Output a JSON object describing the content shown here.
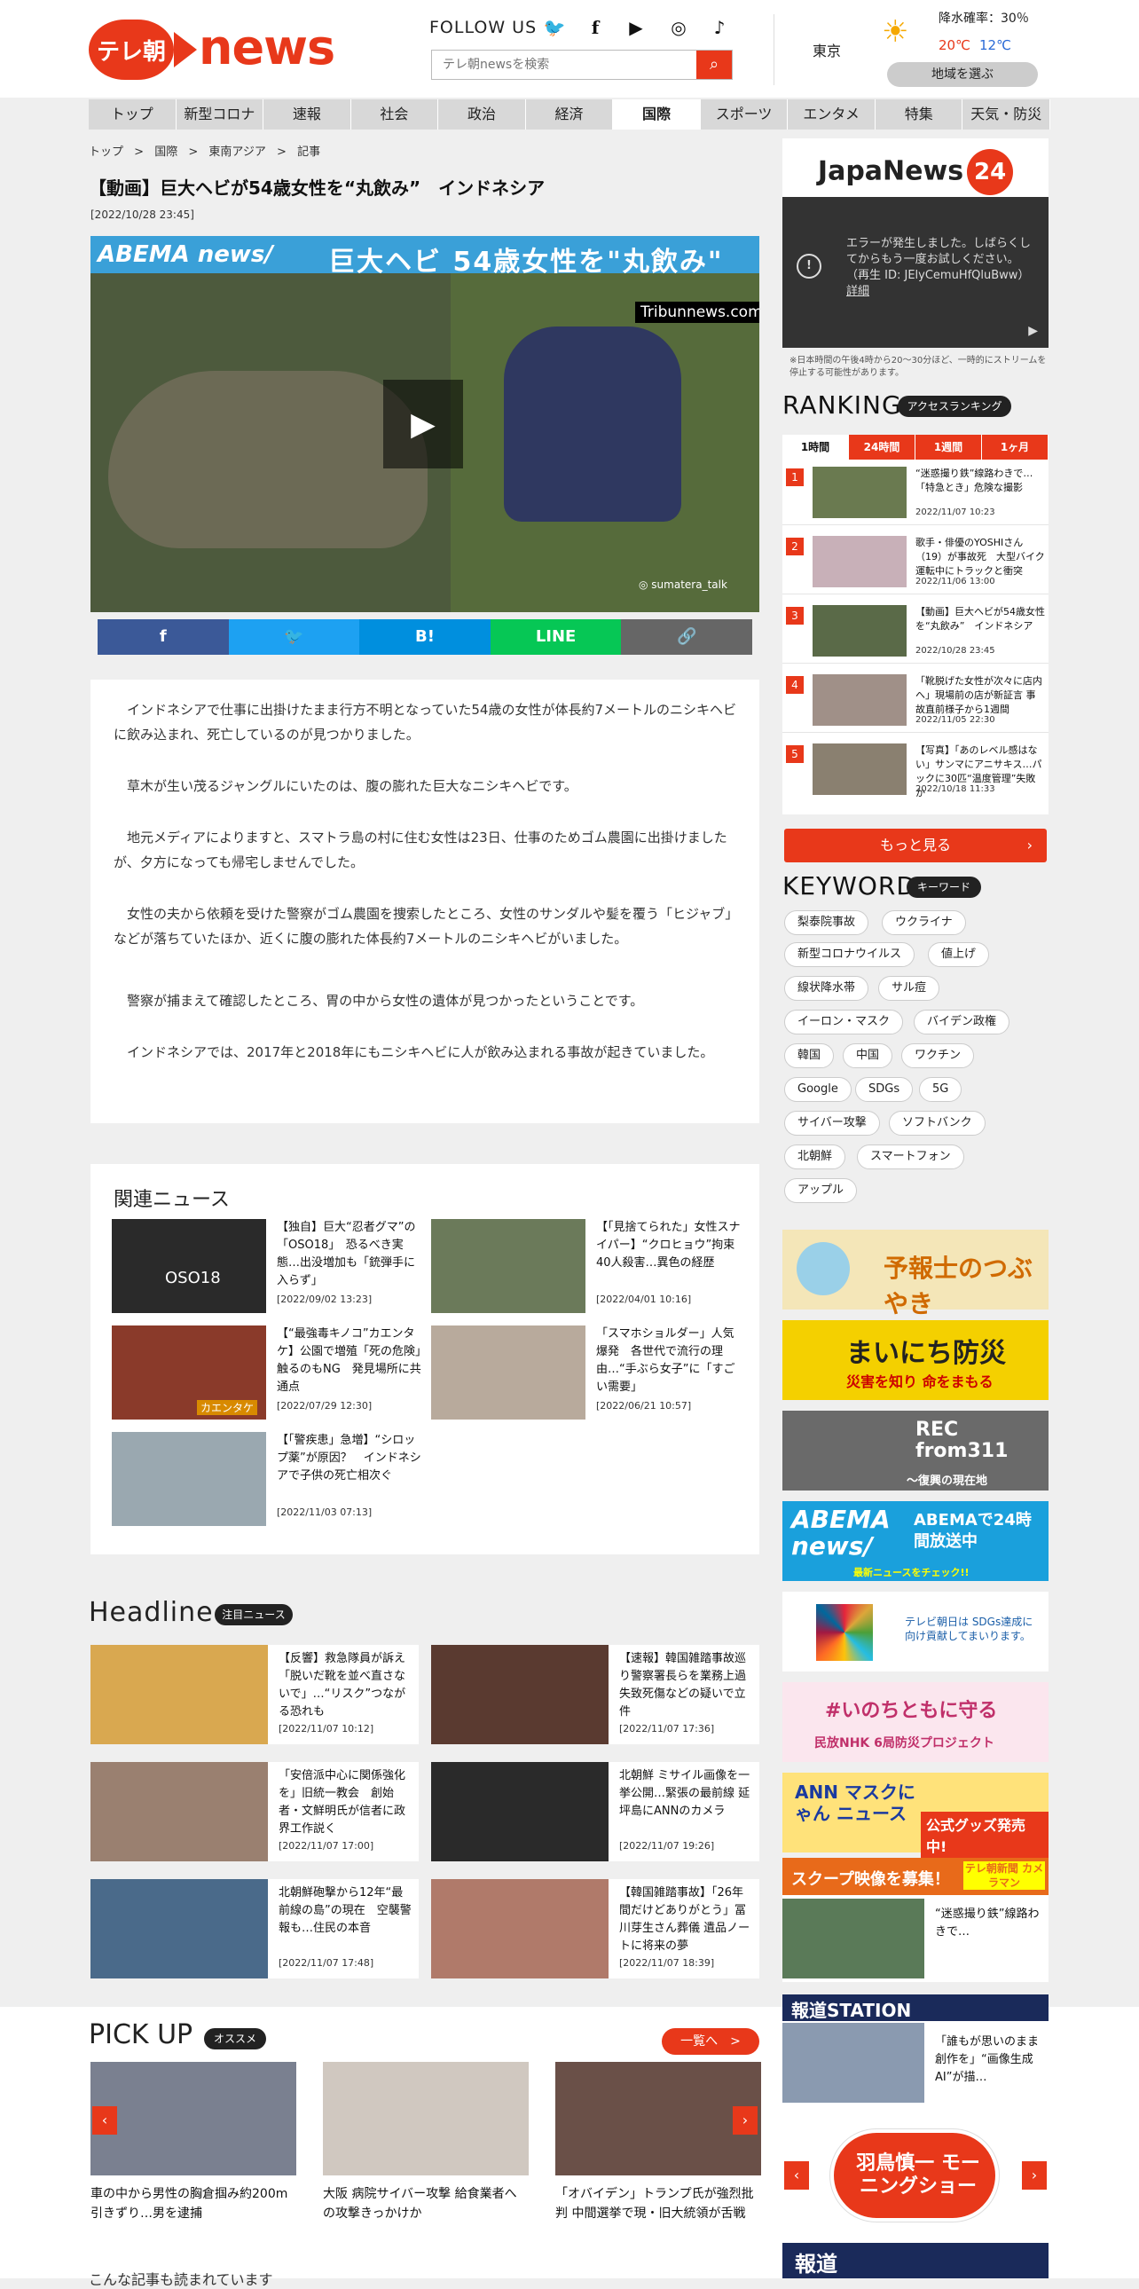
{
  "header": {
    "logo_badge": "テレ朝",
    "logo_word": "news",
    "follow_label": "FOLLOW US",
    "social": [
      "twitter-icon",
      "facebook-icon",
      "youtube-icon",
      "instagram-icon",
      "tiktok-icon"
    ],
    "search_placeholder": "テレ朝newsを検索",
    "weather": {
      "city": "東京",
      "rain_label": "降水確率：30％",
      "high": "20℃",
      "low": "12℃",
      "region_button": "地域を選ぶ"
    }
  },
  "nav": [
    "トップ",
    "新型コロナ",
    "速報",
    "社会",
    "政治",
    "経済",
    "国際",
    "スポーツ",
    "エンタメ",
    "特集",
    "天気・防災"
  ],
  "nav_active": "国際",
  "breadcrumb": [
    "トップ",
    "国際",
    "東南アジア",
    "記事"
  ],
  "article": {
    "title": "【動画】巨大ヘビが54歳女性を“丸飲み”　インドネシア",
    "date": "[2022/10/28 23:45]",
    "video": {
      "brand": "ABEMA news/",
      "caption": "巨大ヘビ 54歳女性を\"丸飲み\"",
      "source": "Tribunnews.com",
      "credit": "sumatera_talk"
    },
    "share": [
      "facebook-icon",
      "twitter-icon",
      "hatena-icon",
      "line-icon",
      "link-icon"
    ],
    "share_labels": [
      "f",
      "🐦",
      "B!",
      "LINE",
      "🔗"
    ],
    "paragraphs": [
      "インドネシアで仕事に出掛けたまま行方不明となっていた54歳の女性が体長約7メートルのニシキヘビに飲み込まれ、死亡しているのが見つかりました。",
      "草木が生い茂るジャングルにいたのは、腹の膨れた巨大なニシキヘビです。",
      "地元メディアによりますと、スマトラ島の村に住む女性は23日、仕事のためゴム農園に出掛けましたが、夕方になっても帰宅しませんでした。",
      "女性の夫から依頼を受けた警察がゴム農園を捜索したところ、女性のサンダルや髪を覆う「ヒジャブ」などが落ちていたほか、近くに腹の膨れた体長約7メートルのニシキヘビがいました。",
      "警察が捕まえて確認したところ、胃の中から女性の遺体が見つかったということです。",
      "インドネシアでは、2017年と2018年にもニシキヘビに人が飲み込まれる事故が起きていました。"
    ]
  },
  "related": {
    "heading": "関連ニュース",
    "items": [
      {
        "title": "【独自】巨大“忍者グマ”の「OSO18」　恐るべき実態…出没増加も「銃弾手に入らず」",
        "date": "[2022/09/02 13:23]",
        "thumb_text": "OSO18"
      },
      {
        "title": "【「見捨てられた」女性スナイパー】“クロヒョウ”拘束　40人殺害…異色の経歴",
        "date": "[2022/04/01 10:16]",
        "thumb_text": ""
      },
      {
        "title": "【“最強毒キノコ”カエンタケ】公園で増殖「死の危険」触るのもNG　発見場所に共通点",
        "date": "[2022/07/29 12:30]",
        "thumb_text": "カエンタケ"
      },
      {
        "title": "「スマホショルダー」人気爆発　各世代で流行の理由…“手ぶら女子”に「すごい需要」",
        "date": "[2022/06/21 10:57]",
        "thumb_text": ""
      },
      {
        "title": "【「警疾患」急増】“シロップ薬”が原因？　インドネシアで子供の死亡相次ぐ",
        "date": "[2022/11/03 07:13]",
        "thumb_text": ""
      }
    ]
  },
  "headline": {
    "heading": "Headline",
    "badge": "注目ニュース",
    "items": [
      {
        "title": "【反響】救急隊員が訴え「脱いだ靴を並べ直さないで」…“リスク”つながる恐れも",
        "date": "[2022/11/07 10:12]"
      },
      {
        "title": "【速報】韓国雑踏事故巡り警察署長らを業務上過失致死傷などの疑いで立件",
        "date": "[2022/11/07 17:36]"
      },
      {
        "title": "「安倍派中心に関係強化を」旧統一教会　創始者・文鮮明氏が信者に政界工作説く",
        "date": "[2022/11/07 17:00]"
      },
      {
        "title": "北朝鮮 ミサイル画像を一挙公開…緊張の最前線 延坪島にANNのカメラ",
        "date": "[2022/11/07 19:26]"
      },
      {
        "title": "北朝鮮砲撃から12年“最前線の島”の現在　空襲警報も…住民の本音",
        "date": "[2022/11/07 17:48]"
      },
      {
        "title": "【韓国雑踏事故】「26年間だけどありがとう」冨川芽生さん葬儀 遺品ノートに将来の夢",
        "date": "[2022/11/07 18:39]"
      }
    ]
  },
  "pickup": {
    "heading": "PICK UP",
    "badge": "オススメ",
    "more": "一覧へ　>",
    "items": [
      {
        "title": "車の中から男性の胸倉掴み約200m引きずり…男を逮捕"
      },
      {
        "title": "大阪 病院サイバー攻撃 給食業者への攻撃きっかけか"
      },
      {
        "title": "「オバイデン」トランプ氏が強烈批判 中間選挙で現・旧大統領が舌戦"
      }
    ]
  },
  "more_articles": "こんな記事も読まれています",
  "sidebar": {
    "japanews": {
      "brand": "JapaNews",
      "num": "24",
      "error": "エラーが発生しました。しばらくしてからもう一度お試しください。（再生 ID: JElyCemuHfQluBww）",
      "detail": "詳細",
      "note": "※日本時間の午後4時から20～30分ほど、一時的にストリームを停止する可能性があります。"
    },
    "ranking": {
      "heading": "RANKING",
      "badge": "アクセスランキング",
      "tabs": [
        "1時間",
        "24時間",
        "1週間",
        "1ヶ月"
      ],
      "items": [
        {
          "num": "1",
          "title": "“迷惑撮り鉄”線路わきで…「特急とき」危険な撮影",
          "date": "2022/11/07 10:23"
        },
        {
          "num": "2",
          "title": "歌手・俳優のYOSHIさん（19）が事故死　大型バイク運転中にトラックと衝突",
          "date": "2022/11/06 13:00"
        },
        {
          "num": "3",
          "title": "【動画】巨大ヘビが54歳女性を“丸飲み”　インドネシア",
          "date": "2022/10/28 23:45"
        },
        {
          "num": "4",
          "title": "「靴脱げた女性が次々に店内へ」現場前の店が新証言 事故直前様子から1週間",
          "date": "2022/11/05 22:30"
        },
        {
          "num": "5",
          "title": "【写真】「あのレベル感はない」サンマにアニサキス…パックに30匹“温度管理”失敗か",
          "date": "2022/10/18 11:33"
        }
      ],
      "more": "もっと見る"
    },
    "keyword": {
      "heading": "KEYWORD",
      "badge": "キーワード",
      "items": [
        "梨泰院事故",
        "ウクライナ",
        "新型コロナウイルス",
        "値上げ",
        "線状降水帯",
        "サル痘",
        "イーロン・マスク",
        "バイデン政権",
        "韓国",
        "中国",
        "ワクチン",
        "Google",
        "SDGs",
        "5G",
        "サイバー攻撃",
        "ソフトバンク",
        "北朝鮮",
        "スマートフォン",
        "アップル"
      ]
    },
    "banners": [
      {
        "text": "予報士のつぶやき"
      },
      {
        "text": "まいにち防災",
        "sub": "災害を知り 命をまもる"
      },
      {
        "text": "REC from311",
        "sub": "～復興の現在地"
      },
      {
        "text": "ABEMA news/",
        "sub": "ABEMAで24時間放送中",
        "sub2": "最新ニュースをチェック!!"
      },
      {
        "text": "テレビ朝日は SDGs達成に向け貢献してまいります。"
      },
      {
        "text": "#いのちともに守る",
        "sub": "民放NHK 6局防災プロジェクト"
      },
      {
        "text": "ANN マスクにゃん ニュース",
        "sub": "公式グッズ発売中!"
      },
      {
        "text": "スクープ映像を募集！",
        "sub": "テレ朝新聞 カメラマン",
        "sub2": "“迷惑撮り鉄”線路わきで…"
      },
      {
        "text": "報道STATION",
        "sub": "「誰もが思いのまま創作を」“画像生成AI”が描…"
      },
      {
        "text": "羽鳥慎一 モーニングショー"
      }
    ],
    "bottom_banner": "報道"
  }
}
